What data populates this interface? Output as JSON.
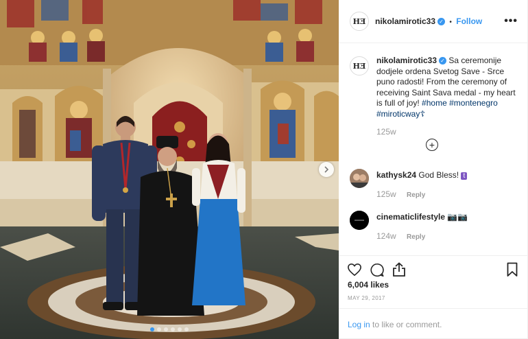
{
  "post": {
    "username": "nikolamirotic33",
    "verified_mark": "✓",
    "separator": "•",
    "follow_label": "Follow",
    "more_label": "•••",
    "avatar_logo_text": "HƎ"
  },
  "caption": {
    "text": "Sa ceremonije dodjele ordena Svetog Save - Srce puno radosti! From the ceremony of receiving Saint Sava medal - my heart is full of joy!",
    "tags": [
      "#home",
      "#montenegro",
      "#miroticway"
    ],
    "tag_suffix": "☦",
    "time": "125w"
  },
  "load_more_icon": "plus-circle-icon",
  "comments": [
    {
      "username": "kathysk24",
      "text": "God Bless!",
      "emoji": "t",
      "time": "125w",
      "reply": "Reply"
    },
    {
      "username": "cinematiclifestyle",
      "text": "📷📷",
      "time": "124w",
      "reply": "Reply"
    }
  ],
  "actions": {
    "icons": [
      "heart-icon",
      "comment-icon",
      "share-icon",
      "bookmark-icon"
    ]
  },
  "likes": "6,004 likes",
  "date": "MAY 29, 2017",
  "footer": {
    "login_link": "Log in",
    "login_rest": " to like or comment."
  },
  "carousel": {
    "total": 6,
    "current": 1
  },
  "colors": {
    "accent": "#3897f0",
    "text": "#262626",
    "muted": "#999999",
    "border": "#efefef",
    "hashtag": "#003569"
  }
}
